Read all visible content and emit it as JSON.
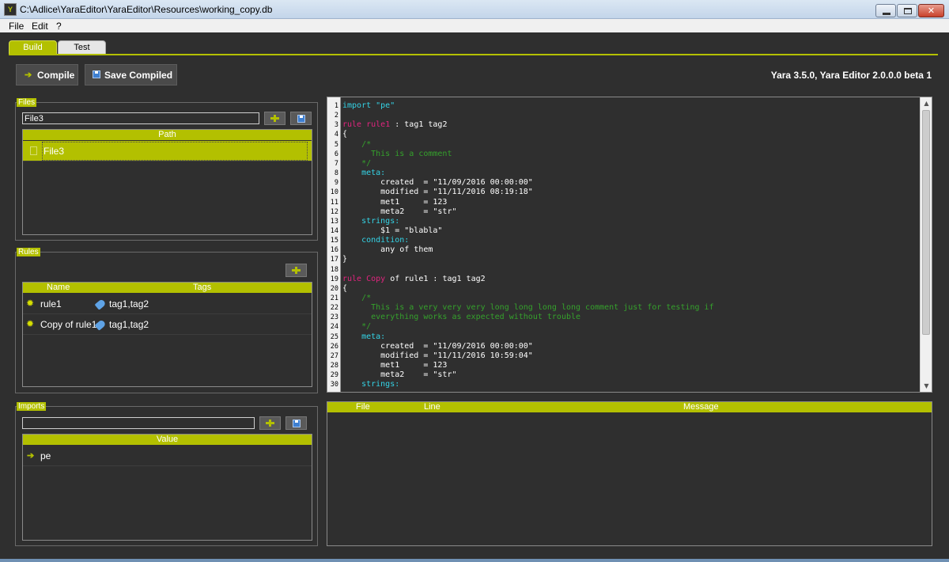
{
  "window": {
    "title": "C:\\Adlice\\YaraEditor\\YaraEditor\\Resources\\working_copy.db",
    "icon_label": "Y"
  },
  "menu": {
    "items": [
      "File",
      "Edit",
      "?"
    ]
  },
  "tabs": [
    {
      "label": "Build",
      "active": true
    },
    {
      "label": "Test",
      "active": false
    }
  ],
  "toolbar": {
    "compile_label": "Compile",
    "save_compiled_label": "Save Compiled"
  },
  "version_text": "Yara 3.5.0, Yara Editor 2.0.0.0 beta 1",
  "files": {
    "group_label": "Files",
    "input_value": "File3",
    "header": "Path",
    "rows": [
      {
        "path": "File3",
        "selected": true
      }
    ]
  },
  "rules": {
    "group_label": "Rules",
    "headers": {
      "name": "Name",
      "tags": "Tags"
    },
    "rows": [
      {
        "name": "rule1",
        "tags": "tag1,tag2"
      },
      {
        "name": "Copy of rule1",
        "tags": "tag1,tag2"
      }
    ]
  },
  "imports": {
    "group_label": "Imports",
    "input_value": "",
    "header": "Value",
    "rows": [
      {
        "value": "pe"
      }
    ]
  },
  "editor": {
    "line_numbers": [
      "1",
      "2",
      "3",
      "4",
      "5",
      "6",
      "7",
      "8",
      "9",
      "10",
      "11",
      "12",
      "13",
      "14",
      "15",
      "16",
      "17",
      "18",
      "19",
      "20",
      "21",
      "22",
      "23",
      "24",
      "25",
      "26",
      "27",
      "28",
      "29",
      "30"
    ],
    "lines": [
      [
        {
          "t": "import \"pe\"",
          "c": "kw-cyan"
        }
      ],
      [],
      [
        {
          "t": "rule ",
          "c": "kw-pink"
        },
        {
          "t": "rule1",
          "c": "kw-pink"
        },
        {
          "t": " : tag1 tag2",
          "c": ""
        }
      ],
      [
        {
          "t": "{",
          "c": ""
        }
      ],
      [
        {
          "t": "    /*",
          "c": "cm"
        }
      ],
      [
        {
          "t": "      This is a comment",
          "c": "cm"
        }
      ],
      [
        {
          "t": "    */",
          "c": "cm"
        }
      ],
      [
        {
          "t": "    meta:",
          "c": "kw-cyan"
        }
      ],
      [
        {
          "t": "        created  = \"11/09/2016 00:00:00\"",
          "c": ""
        }
      ],
      [
        {
          "t": "        modified = \"11/11/2016 08:19:18\"",
          "c": ""
        }
      ],
      [
        {
          "t": "        met1     = 123",
          "c": ""
        }
      ],
      [
        {
          "t": "        meta2    = \"str\"",
          "c": ""
        }
      ],
      [
        {
          "t": "    strings:",
          "c": "kw-cyan"
        }
      ],
      [
        {
          "t": "        $1 = \"blabla\"",
          "c": ""
        }
      ],
      [
        {
          "t": "    condition:",
          "c": "kw-cyan"
        }
      ],
      [
        {
          "t": "        any of them",
          "c": ""
        }
      ],
      [
        {
          "t": "}",
          "c": ""
        }
      ],
      [],
      [
        {
          "t": "rule ",
          "c": "kw-pink"
        },
        {
          "t": "Copy",
          "c": "kw-pink"
        },
        {
          "t": " of rule1 : tag1 tag2",
          "c": ""
        }
      ],
      [
        {
          "t": "{",
          "c": ""
        }
      ],
      [
        {
          "t": "    /*",
          "c": "cm"
        }
      ],
      [
        {
          "t": "      This is a very very very long long long long comment just for testing if",
          "c": "cm"
        }
      ],
      [
        {
          "t": "      everything works as expected without trouble",
          "c": "cm"
        }
      ],
      [
        {
          "t": "    */",
          "c": "cm"
        }
      ],
      [
        {
          "t": "    meta:",
          "c": "kw-cyan"
        }
      ],
      [
        {
          "t": "        created  = \"11/09/2016 00:00:00\"",
          "c": ""
        }
      ],
      [
        {
          "t": "        modified = \"11/11/2016 10:59:04\"",
          "c": ""
        }
      ],
      [
        {
          "t": "        met1     = 123",
          "c": ""
        }
      ],
      [
        {
          "t": "        meta2    = \"str\"",
          "c": ""
        }
      ],
      [
        {
          "t": "    strings:",
          "c": "kw-cyan"
        }
      ]
    ]
  },
  "messages": {
    "headers": [
      "File",
      "Line",
      "Message"
    ]
  },
  "colors": {
    "accent": "#b3c000",
    "background": "#2f2f2f",
    "keyword": "#34d3e6",
    "rule": "#e0247e",
    "comment": "#35a12c"
  }
}
